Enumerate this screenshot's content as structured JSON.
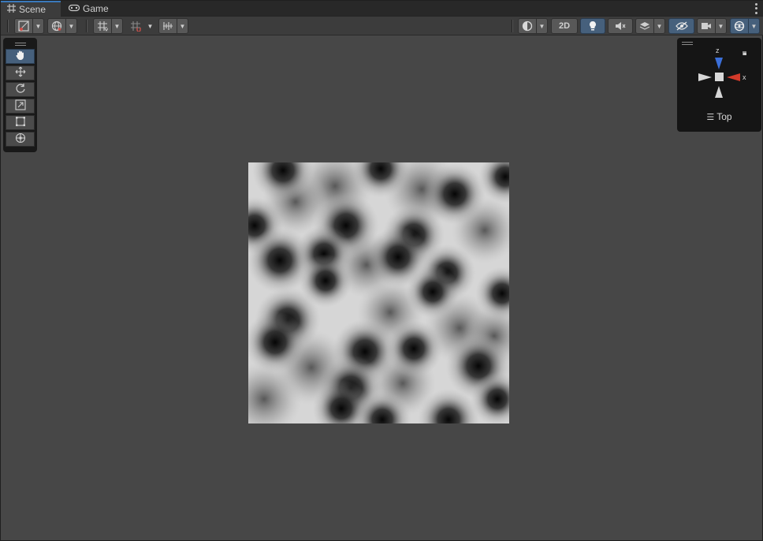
{
  "tabs": [
    {
      "label": "Scene",
      "icon": "grid-icon",
      "active": true
    },
    {
      "label": "Game",
      "icon": "gamepad-icon",
      "active": false
    }
  ],
  "toolbar": {
    "mode_2d_label": "2D"
  },
  "gizmo": {
    "axis_z": "z",
    "axis_x": "x",
    "view_label": "Top"
  },
  "colors": {
    "accent_blue": "#46607c",
    "tab_highlight": "#3a79bb",
    "axis_x": "#d23a2a",
    "axis_z": "#3b6fd9",
    "background": "#474747"
  }
}
